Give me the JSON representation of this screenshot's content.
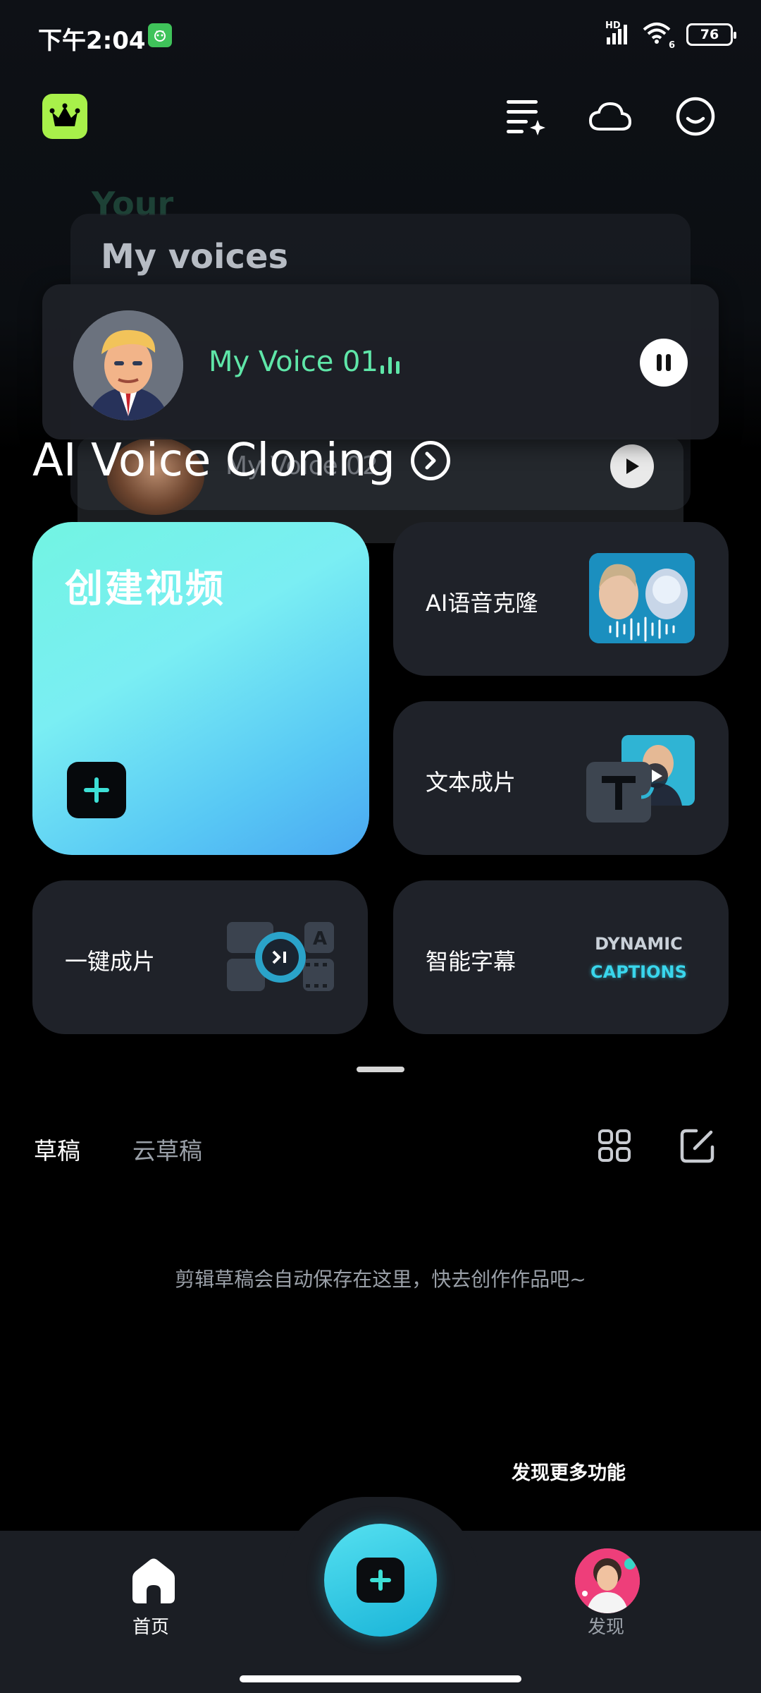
{
  "status_bar": {
    "time": "下午2:04",
    "network": "HD",
    "wifi_label": "6",
    "battery": "76"
  },
  "header": {
    "crown_icon": "crown-icon",
    "task_list_icon": "sparkle-list-icon",
    "cloud_icon": "cloud-icon",
    "profile_icon": "smiley-icon"
  },
  "banner": {
    "ghost_title": "Your",
    "card_title": "My voices",
    "back_voice": "My Voice 02",
    "front_voice": "My Voice 01",
    "headline": "AI Voice Cloning"
  },
  "features": {
    "create_video": "创建视频",
    "ai_voice_clone": "AI语音克隆",
    "text_to_video": "文本成片",
    "one_click": "一键成片",
    "smart_captions": "智能字幕",
    "caption_line1": "DYNAMIC",
    "caption_line2": "CAPTIONS"
  },
  "drafts": {
    "tab_local": "草稿",
    "tab_cloud": "云草稿",
    "empty_message": "剪辑草稿会自动保存在这里，快去创作作品吧~"
  },
  "discover_more": "发现更多功能",
  "bottom_nav": {
    "home": "首页",
    "discover": "发现"
  },
  "colors": {
    "accent_green": "#a8f04a",
    "voice_green": "#5fe6a8",
    "fab_cyan": "#19b4d8"
  }
}
